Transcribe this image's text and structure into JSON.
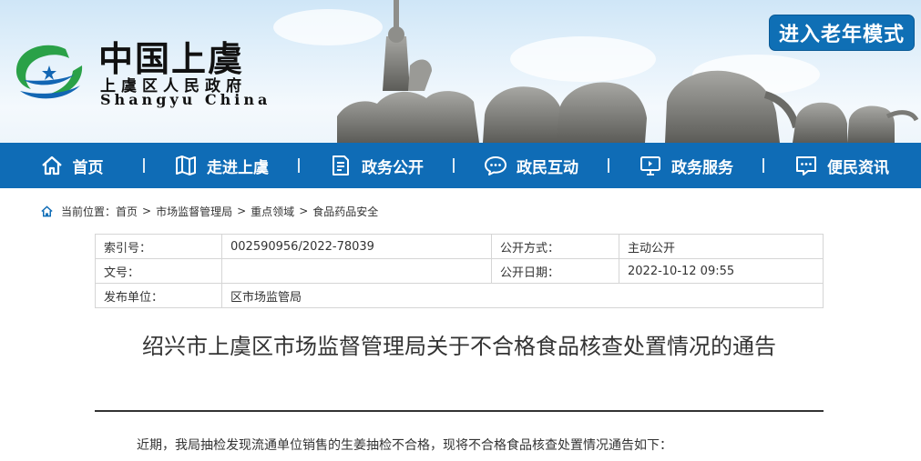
{
  "header": {
    "brand_cn": "中国上虞",
    "brand_sub": "上虞区人民政府",
    "brand_en": "Shangyu China",
    "elder_mode_label": "进入老年模式"
  },
  "nav": {
    "items": [
      {
        "label": "首页",
        "icon": "home-icon"
      },
      {
        "label": "走进上虞",
        "icon": "map-icon"
      },
      {
        "label": "政务公开",
        "icon": "document-icon"
      },
      {
        "label": "政民互动",
        "icon": "chat-icon"
      },
      {
        "label": "政务服务",
        "icon": "monitor-icon"
      },
      {
        "label": "便民资讯",
        "icon": "message-icon"
      }
    ]
  },
  "breadcrumb": {
    "prefix": "当前位置：",
    "items": [
      "首页",
      "市场监督管理局",
      "重点领域",
      "食品药品安全"
    ],
    "separator": ">"
  },
  "info": {
    "index_label": "索引号：",
    "index_value": "002590956/2022-78039",
    "method_label": "公开方式：",
    "method_value": "主动公开",
    "docno_label": "文号：",
    "docno_value": "",
    "date_label": "公开日期：",
    "date_value": "2022-10-12 09:55",
    "publisher_label": "发布单位：",
    "publisher_value": "区市场监管局"
  },
  "article": {
    "title": "绍兴市上虞区市场监督管理局关于不合格食品核查处置情况的通告",
    "intro": "近期，我局抽检发现流通单位销售的生姜抽检不合格，现将不合格食品核查处置情况通告如下："
  },
  "colors": {
    "nav_bg": "#0f6cb6",
    "elder_btn_bg": "#0f6fb5",
    "logo_green": "#2aa148",
    "logo_blue": "#1266b3"
  }
}
